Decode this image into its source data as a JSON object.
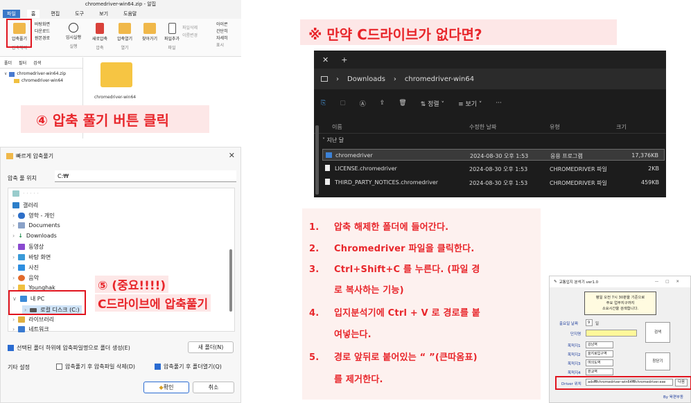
{
  "zip_window": {
    "title": "chromedriver-win64.zip - 알집",
    "tabs": [
      "파일",
      "홈",
      "편집",
      "도구",
      "보기",
      "도움말"
    ],
    "ribbon": {
      "extract": "압축풀기",
      "extract_sub": "압축해제",
      "wallpaper": "바탕화면",
      "download": "다운로드",
      "original": "원본경로",
      "temp_run": "임시실행",
      "run_group": "실행",
      "new_zip": "새로압축",
      "zip_group": "압축",
      "open_zip": "압축열기",
      "open_group": "열기",
      "find": "찾아가기",
      "add": "파일추가",
      "delete": "파일삭제",
      "rename": "이름변경",
      "file_group": "파일",
      "icons": "아이콘",
      "brief": "간단히",
      "detail": "자세히",
      "show_group": "표시"
    },
    "pane_tabs": [
      "폴더",
      "필터",
      "검색"
    ],
    "tree": [
      "chromedriver-win64.zip",
      "chromedriver-win64"
    ],
    "folder_name": "chromedriver-win64"
  },
  "step4": "④ 압축 풀기 버튼 클릭",
  "dialog": {
    "title": "빠르게 압축풀기",
    "location_label": "압축 풀 위치",
    "location_value": "C:₩",
    "tree": [
      "갤러리",
      "영학 - 개인",
      "Documents",
      "Downloads",
      "동영상",
      "바탕 화면",
      "사진",
      "음악",
      "Younghak",
      "내 PC",
      "로컬 디스크 (C:)",
      "라이브러리",
      "네트워크"
    ],
    "create_folder_option": "선택된 폴더 하위에 압축파일명으로 폴더 생성(E)",
    "new_folder": "새 폴더(N)",
    "other_label": "기타 설정",
    "delete_after": "압축풀기 후 압축파일 삭제(D)",
    "open_after": "압축풀기 후 폴더열기(Q)",
    "ok": "확인",
    "cancel": "취소"
  },
  "step5_line1": "⑤ (중요!!!!)",
  "step5_line2": "C드라이브에 압축풀기",
  "no_c_heading": "※ 만약 C드라이브가 없다면?",
  "explorer": {
    "path": [
      "Downloads",
      "chromedriver-win64"
    ],
    "sort": "정렬",
    "view": "보기",
    "columns": [
      "이름",
      "수정한 날짜",
      "유형",
      "크기"
    ],
    "group": "지난 달",
    "rows": [
      {
        "name": "chromedriver",
        "date": "2024-08-30 오후 1:53",
        "type": "응용 프로그램",
        "size": "17,376KB"
      },
      {
        "name": "LICENSE.chromedriver",
        "date": "2024-08-30 오후 1:53",
        "type": "CHROMEDRIVER 파일",
        "size": "2KB"
      },
      {
        "name": "THIRD_PARTY_NOTICES.chromedriver",
        "date": "2024-08-30 오후 1:53",
        "type": "CHROMEDRIVER 파일",
        "size": "459KB"
      }
    ]
  },
  "instructions": [
    {
      "num": "1.",
      "text": "압축 해제한 폴더에 들어간다."
    },
    {
      "num": "2.",
      "text": "Chromedriver 파일을 클릭한다."
    },
    {
      "num": "3.",
      "text": "Ctrl+Shift+C 를 누른다. (파일 경"
    },
    {
      "num": "",
      "text": "로 복사하는 기능)"
    },
    {
      "num": "4.",
      "text": "입지분석기에 Ctrl + V 로 경로를 붙"
    },
    {
      "num": "",
      "text": "여넣는다."
    },
    {
      "num": "5.",
      "text": "경로 앞뒤로 붙어있는 “ ”(큰따옴표)"
    },
    {
      "num": "",
      "text": "를 제거한다."
    }
  ],
  "analyzer": {
    "title": "교통입지 분석기 ver1.0",
    "notice": [
      "평일 오전 7시 30분을 기준으로",
      "주요 업무지구까지",
      "소요시간을 검색합니다."
    ],
    "date_label": "출요일 날짜",
    "date_value": "9",
    "date_unit": "일",
    "complex_label": "단지명",
    "dest_labels": [
      "목적지1",
      "목적지2",
      "목적지3",
      "목적지4"
    ],
    "dest_values": [
      "강남역",
      "을지로입구역",
      "여의도역",
      "판교역"
    ],
    "search": "검색",
    "close": "창닫기",
    "driver_label": "Driver 위치",
    "driver_value": "ads₩chromedriver-win64₩chromedriver.exe",
    "next": "다음",
    "credit": "By 육편부동"
  },
  "colors": {
    "accent_red": "#e8262b",
    "banner_pink": "#fde7e7"
  }
}
